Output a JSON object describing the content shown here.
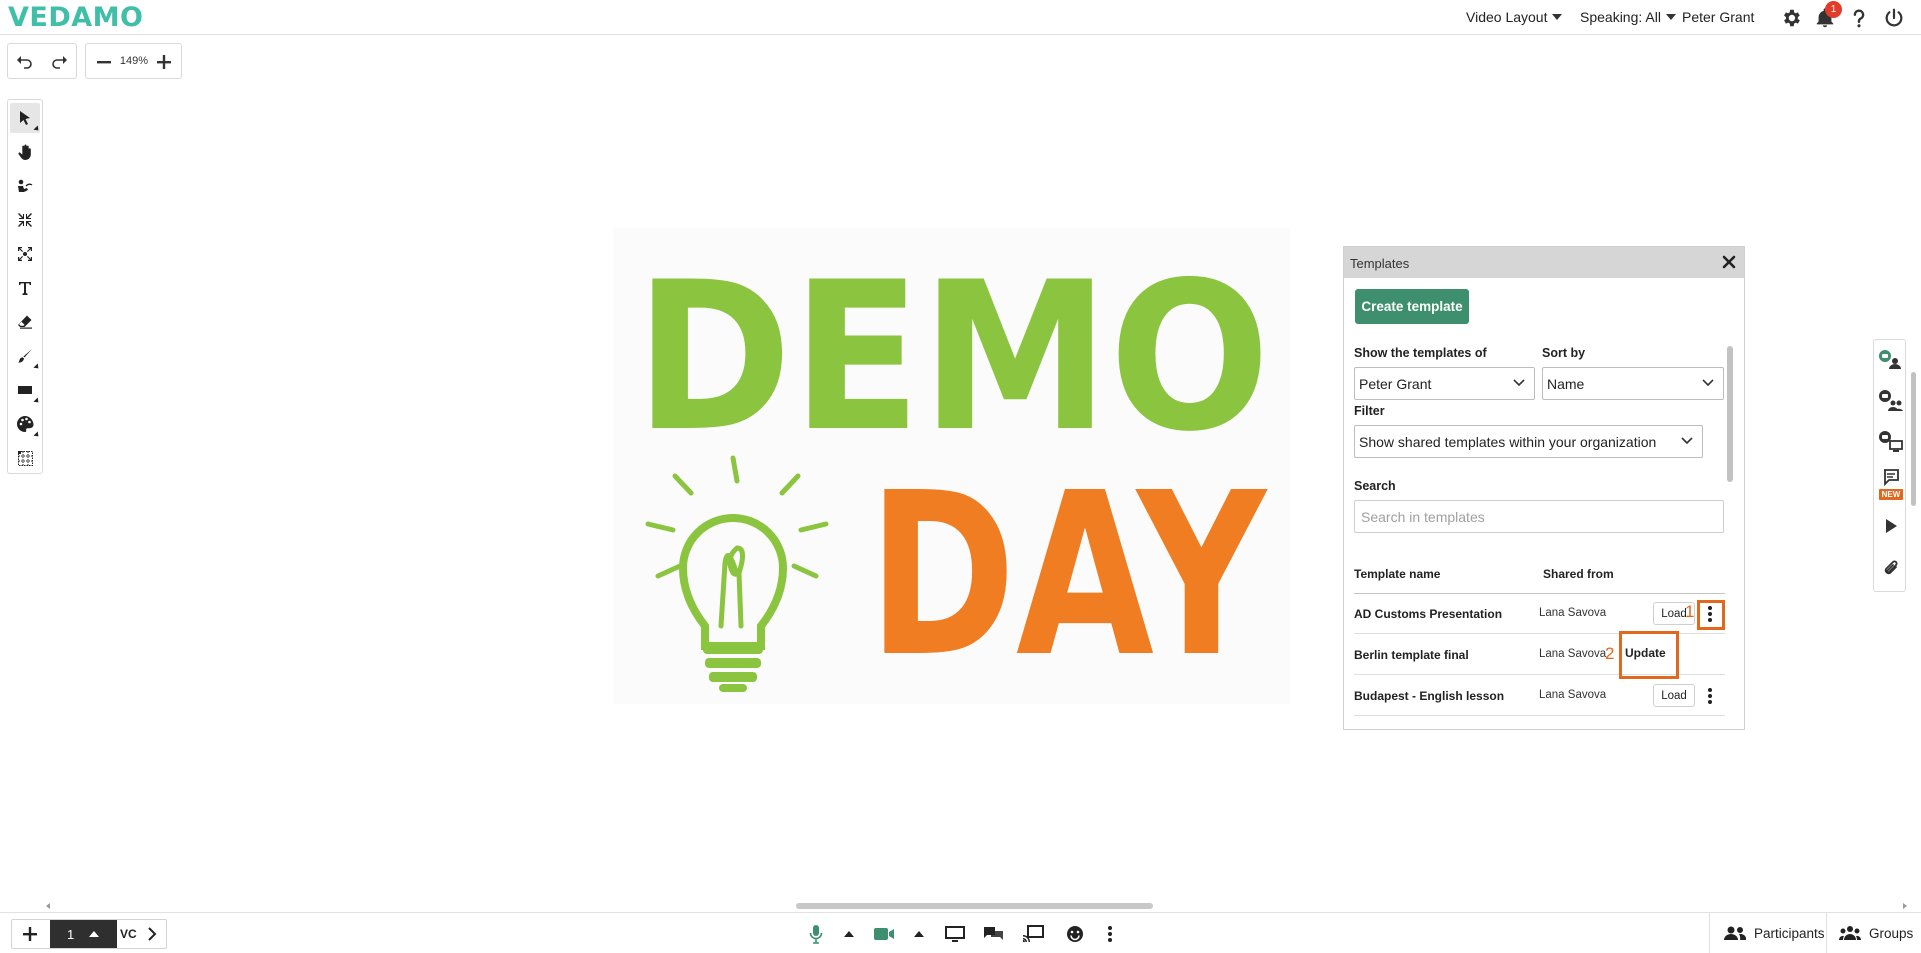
{
  "app": {
    "logo": "VEDAMO"
  },
  "topbar": {
    "video_layout": "Video Layout",
    "speaking": "Speaking: All",
    "user_name": "Peter Grant",
    "notifications_count": "1"
  },
  "toolbar": {
    "zoom": "149%"
  },
  "canvas": {
    "image_line1": "DEMO",
    "image_line2": "DAY"
  },
  "templates_panel": {
    "title": "Templates",
    "create_button": "Create template",
    "show_label": "Show the templates of",
    "show_value": "Peter Grant",
    "sort_label": "Sort by",
    "sort_value": "Name",
    "filter_label": "Filter",
    "filter_value": "Show shared templates within your organization",
    "search_label": "Search",
    "search_placeholder": "Search in templates",
    "col_name": "Template name",
    "col_shared": "Shared from",
    "load_label": "Load",
    "update_label": "Update",
    "rows": [
      {
        "name": "AD Customs Presentation",
        "shared": "Lana Savova"
      },
      {
        "name": "Berlin template final",
        "shared": "Lana Savova"
      },
      {
        "name": "Budapest - English lesson",
        "shared": "Lana Savova"
      }
    ],
    "annotations": {
      "num1": "1",
      "num2": "2"
    }
  },
  "right_strip": {
    "new_badge": "NEW"
  },
  "bottombar": {
    "page_number": "1",
    "page_label": "VC",
    "participants": "Participants",
    "groups": "Groups"
  },
  "colors": {
    "brand": "#3fbfa8",
    "create_button": "#3d8f6d",
    "annotation": "#e2681e",
    "demo_green": "#8bc43f",
    "demo_orange": "#f07d22"
  }
}
